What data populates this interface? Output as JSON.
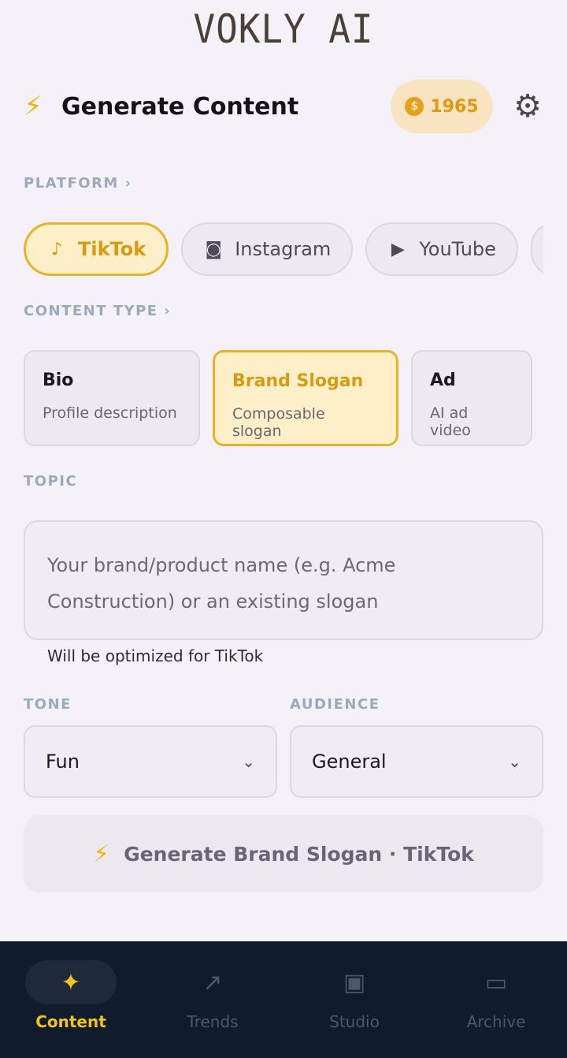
{
  "app": {
    "logo": "VOKLY AI"
  },
  "header": {
    "bolt_icon": "⚡",
    "title": "Generate Content",
    "credits": "1965",
    "coin_symbol": "$"
  },
  "platform": {
    "label": "PLATFORM ›",
    "items": [
      {
        "label": "TikTok",
        "icon": "music-note-icon",
        "glyph": "♪",
        "active": true
      },
      {
        "label": "Instagram",
        "icon": "camera-icon",
        "glyph": "◙",
        "active": false
      },
      {
        "label": "YouTube",
        "icon": "play-circle-icon",
        "glyph": "▶",
        "active": false
      }
    ],
    "more_glyph": "›"
  },
  "content_type": {
    "label": "CONTENT TYPE ›",
    "items": [
      {
        "title": "Bio",
        "subtitle": "Profile description",
        "active": false
      },
      {
        "title": "Brand Slogan",
        "subtitle": "Composable slogan",
        "active": true
      },
      {
        "title": "Ad",
        "subtitle": "AI ad video",
        "active": false
      }
    ]
  },
  "topic": {
    "label": "TOPIC",
    "placeholder": "Your brand/product name (e.g. Acme Construction) or an existing slogan",
    "hint": "Will be optimized for TikTok"
  },
  "tone": {
    "label": "TONE",
    "value": "Fun"
  },
  "audience": {
    "label": "AUDIENCE",
    "value": "General"
  },
  "chevron": "⌄",
  "generate_button": {
    "label": "Generate Brand Slogan · TikTok",
    "icon": "⚡"
  },
  "bottom_nav": {
    "items": [
      {
        "label": "Content",
        "icon": "sparkles-icon",
        "glyph": "✦",
        "active": true
      },
      {
        "label": "Trends",
        "icon": "trending-up-icon",
        "glyph": "↗",
        "active": false
      },
      {
        "label": "Studio",
        "icon": "video-add-icon",
        "glyph": "▣",
        "active": false
      },
      {
        "label": "Archive",
        "icon": "folder-icon",
        "glyph": "▭",
        "active": false
      }
    ]
  },
  "colors": {
    "accent": "#e8b426",
    "nav_bg": "#101c2c",
    "active_nav": "#f5c416"
  }
}
